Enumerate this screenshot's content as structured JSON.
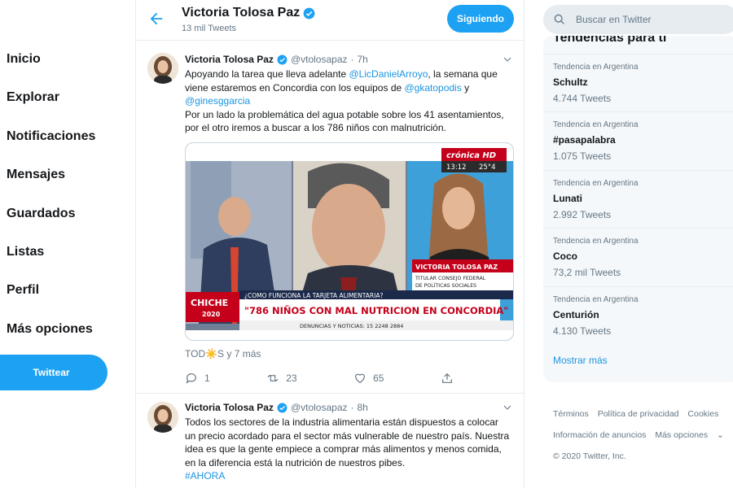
{
  "nav": {
    "items": [
      "Inicio",
      "Explorar",
      "Notificaciones",
      "Mensajes",
      "Guardados",
      "Listas",
      "Perfil",
      "Más opciones"
    ],
    "tweet_button": "Twittear"
  },
  "header": {
    "name": "Victoria Tolosa Paz",
    "tweet_count": "13 mil Tweets",
    "follow_button": "Siguiendo"
  },
  "tweets": [
    {
      "name": "Victoria Tolosa Paz",
      "handle": "@vtolosapaz",
      "time": "7h",
      "text_parts": [
        {
          "t": "Apoyando la tarea que lleva adelante "
        },
        {
          "t": "@LicDanielArroyo",
          "m": true
        },
        {
          "t": ", la semana que viene estaremos en Concordia con los equipos de "
        },
        {
          "t": "@gkatopodis",
          "m": true
        },
        {
          "t": "  y "
        },
        {
          "t": "@ginesggarcia",
          "m": true
        },
        {
          "t": "\nPor un lado la problemática del agua potable sobre los 41 asentamientos, por el otro iremos a buscar a los 786 niños con malnutrición."
        }
      ],
      "media": {
        "logo": "crónica HD",
        "clock": "13:12",
        "temp": "25°4",
        "name_banner": "VICTORIA TOLOSA PAZ",
        "role_banner": "TITULAR CONSEJO FEDERAL DE POLÍTICAS SOCIALES",
        "question": "¿COMO FUNCIONA LA TARJETA ALIMENTARIA?",
        "headline": "\"786 NIÑOS CON MAL NUTRICION EN CONCORDIA\"",
        "ticker": "DENUNCIAS Y NOTICIAS: 15 2248 2884",
        "program": "CHICHE",
        "program_year": "2020"
      },
      "footer_line": "TOD☀️S y 7 más",
      "replies": "1",
      "retweets": "23",
      "likes": "65"
    },
    {
      "name": "Victoria Tolosa Paz",
      "handle": "@vtolosapaz",
      "time": "8h",
      "text_parts": [
        {
          "t": "Todos los sectores de la industria alimentaria están dispuestos a colocar un precio acordado para el sector más vulnerable de nuestro país. Nuestra idea es que la gente empiece a comprar más alimentos y menos comida, en la diferencia está la nutrición de nuestros pibes.\n"
        },
        {
          "t": "#AHORA",
          "m": true
        }
      ]
    }
  ],
  "search": {
    "placeholder": "Buscar en Twitter"
  },
  "trends": {
    "title": "Tendencias para ti",
    "items": [
      {
        "context": "Tendencia en Argentina",
        "name": "Schultz",
        "count": "4.744 Tweets"
      },
      {
        "context": "Tendencia en Argentina",
        "name": "#pasapalabra",
        "count": "1.075 Tweets"
      },
      {
        "context": "Tendencia en Argentina",
        "name": "Lunati",
        "count": "2.992 Tweets"
      },
      {
        "context": "Tendencia en Argentina",
        "name": "Coco",
        "count": "73,2 mil Tweets"
      },
      {
        "context": "Tendencia en Argentina",
        "name": "Centurión",
        "count": "4.130 Tweets"
      }
    ],
    "show_more": "Mostrar más"
  },
  "footer": {
    "links": [
      "Términos",
      "Política de privacidad",
      "Cookies",
      "Información de anuncios",
      "Más opciones"
    ],
    "copyright": "© 2020 Twitter, Inc."
  },
  "colors": {
    "accent": "#1da1f2",
    "link": "#1b95e0",
    "muted": "#657786"
  }
}
